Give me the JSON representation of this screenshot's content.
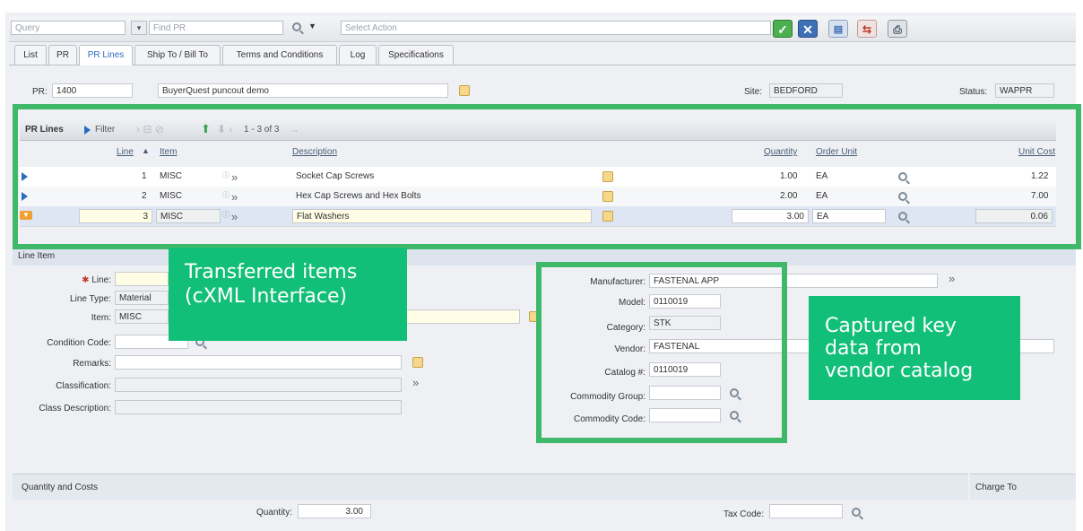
{
  "toolbar": {
    "query_label": "Query",
    "find_placeholder": "Find PR",
    "select_action": "Select Action",
    "icons": [
      "check-icon",
      "close-icon",
      "report-icon",
      "workflow-icon",
      "print-icon"
    ]
  },
  "tabs": [
    {
      "label": "List"
    },
    {
      "label": "PR"
    },
    {
      "label": "PR Lines",
      "active": true
    },
    {
      "label": "Ship To / Bill To"
    },
    {
      "label": "Terms and Conditions"
    },
    {
      "label": "Log"
    },
    {
      "label": "Specifications"
    }
  ],
  "header": {
    "pr_label": "PR:",
    "pr_value": "1400",
    "description": "BuyerQuest puncout demo",
    "site_label": "Site:",
    "site_value": "BEDFORD",
    "status_label": "Status:",
    "status_value": "WAPPR"
  },
  "pr_lines": {
    "title": "PR Lines",
    "filter_label": "Filter",
    "pagination": "1 - 3 of 3",
    "columns": {
      "line": "Line",
      "item": "Item",
      "description": "Description",
      "quantity": "Quantity",
      "order_unit": "Order Unit",
      "unit_cost": "Unit Cost"
    },
    "rows": [
      {
        "line": "1",
        "item": "MISC",
        "description": "Socket Cap Screws",
        "quantity": "1.00",
        "order_unit": "EA",
        "unit_cost": "1.22"
      },
      {
        "line": "2",
        "item": "MISC",
        "description": "Hex Cap Screws and Hex Bolts",
        "quantity": "2.00",
        "order_unit": "EA",
        "unit_cost": "7.00"
      },
      {
        "line": "3",
        "item": "MISC",
        "description": "Flat Washers",
        "quantity": "3.00",
        "order_unit": "EA",
        "unit_cost": "0.06"
      }
    ]
  },
  "line_item": {
    "title": "Line Item",
    "line_label": "Line:",
    "line_type_label": "Line Type:",
    "line_type_value": "Material",
    "item_label": "Item:",
    "item_value": "MISC",
    "condition_code_label": "Condition Code:",
    "remarks_label": "Remarks:",
    "classification_label": "Classification:",
    "class_description_label": "Class Description:"
  },
  "vendor_info": {
    "manufacturer_label": "Manufacturer:",
    "manufacturer_value": "FASTENAL APP",
    "model_label": "Model:",
    "model_value": "0110019",
    "category_label": "Category:",
    "category_value": "STK",
    "vendor_label": "Vendor:",
    "vendor_value": "FASTENAL",
    "catalog_label": "Catalog #:",
    "catalog_value": "0110019",
    "commodity_group_label": "Commodity Group:",
    "commodity_code_label": "Commodity Code:"
  },
  "quantity_costs": {
    "title": "Quantity and Costs",
    "charge_to": "Charge To",
    "quantity_label": "Quantity:",
    "quantity_value": "3.00",
    "tax_code_label": "Tax Code:"
  },
  "callouts": {
    "transferred_line1": "Transferred items",
    "transferred_line2": "(cXML Interface)",
    "captured_line1": "Captured key",
    "captured_line2": "data from",
    "captured_line3": "vendor catalog"
  },
  "colors": {
    "highlight_border": "#3fb86a",
    "callout_bg": "#12bf78",
    "link_blue": "#2c6cc0"
  }
}
